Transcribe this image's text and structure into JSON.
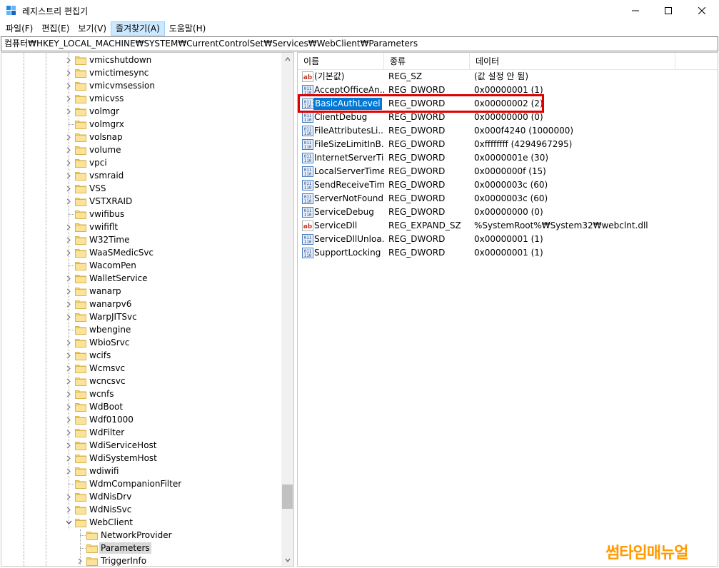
{
  "window": {
    "title": "레지스트리 편집기",
    "minimize_icon": "minimize-icon",
    "maximize_icon": "maximize-icon",
    "close_icon": "close-icon"
  },
  "menu": {
    "items": [
      "파일(F)",
      "편집(E)",
      "보기(V)",
      "즐겨찾기(A)",
      "도움말(H)"
    ],
    "active": "즐겨찾기(A)"
  },
  "address": "컴퓨터₩HKEY_LOCAL_MACHINE₩SYSTEM₩CurrentControlSet₩Services₩WebClient₩Parameters",
  "tree": {
    "items": [
      {
        "label": "vmicshutdown",
        "expander": "collapsed"
      },
      {
        "label": "vmictimesync",
        "expander": "collapsed"
      },
      {
        "label": "vmicvmsession",
        "expander": "collapsed"
      },
      {
        "label": "vmicvss",
        "expander": "collapsed"
      },
      {
        "label": "volmgr",
        "expander": "collapsed"
      },
      {
        "label": "volmgrx",
        "expander": "none"
      },
      {
        "label": "volsnap",
        "expander": "collapsed"
      },
      {
        "label": "volume",
        "expander": "collapsed"
      },
      {
        "label": "vpci",
        "expander": "collapsed"
      },
      {
        "label": "vsmraid",
        "expander": "collapsed"
      },
      {
        "label": "VSS",
        "expander": "collapsed"
      },
      {
        "label": "VSTXRAID",
        "expander": "collapsed"
      },
      {
        "label": "vwifibus",
        "expander": "none"
      },
      {
        "label": "vwififlt",
        "expander": "collapsed"
      },
      {
        "label": "W32Time",
        "expander": "collapsed"
      },
      {
        "label": "WaaSMedicSvc",
        "expander": "collapsed"
      },
      {
        "label": "WacomPen",
        "expander": "none"
      },
      {
        "label": "WalletService",
        "expander": "collapsed"
      },
      {
        "label": "wanarp",
        "expander": "collapsed"
      },
      {
        "label": "wanarpv6",
        "expander": "collapsed"
      },
      {
        "label": "WarpJITSvc",
        "expander": "collapsed"
      },
      {
        "label": "wbengine",
        "expander": "none"
      },
      {
        "label": "WbioSrvc",
        "expander": "collapsed"
      },
      {
        "label": "wcifs",
        "expander": "collapsed"
      },
      {
        "label": "Wcmsvc",
        "expander": "collapsed"
      },
      {
        "label": "wcncsvc",
        "expander": "collapsed"
      },
      {
        "label": "wcnfs",
        "expander": "collapsed"
      },
      {
        "label": "WdBoot",
        "expander": "collapsed"
      },
      {
        "label": "Wdf01000",
        "expander": "collapsed"
      },
      {
        "label": "WdFilter",
        "expander": "collapsed"
      },
      {
        "label": "WdiServiceHost",
        "expander": "collapsed"
      },
      {
        "label": "WdiSystemHost",
        "expander": "collapsed"
      },
      {
        "label": "wdiwifi",
        "expander": "collapsed"
      },
      {
        "label": "WdmCompanionFilter",
        "expander": "none"
      },
      {
        "label": "WdNisDrv",
        "expander": "collapsed"
      },
      {
        "label": "WdNisSvc",
        "expander": "collapsed"
      },
      {
        "label": "WebClient",
        "expander": "expanded"
      },
      {
        "label": "NetworkProvider",
        "expander": "none",
        "child": true
      },
      {
        "label": "Parameters",
        "expander": "none",
        "child": true,
        "selected": true
      },
      {
        "label": "TriggerInfo",
        "expander": "collapsed",
        "child": true
      }
    ]
  },
  "list": {
    "columns": [
      "이름",
      "종류",
      "데이터"
    ],
    "rows": [
      {
        "icon": "string-value-icon",
        "name": "(기본값)",
        "type": "REG_SZ",
        "data": "(값 설정 안 됨)"
      },
      {
        "icon": "binary-value-icon",
        "name": "AcceptOfficeAn...",
        "type": "REG_DWORD",
        "data": "0x00000001 (1)"
      },
      {
        "icon": "binary-value-icon",
        "name": "BasicAuthLevel",
        "type": "REG_DWORD",
        "data": "0x00000002 (2)",
        "selected": true
      },
      {
        "icon": "binary-value-icon",
        "name": "ClientDebug",
        "type": "REG_DWORD",
        "data": "0x00000000 (0)"
      },
      {
        "icon": "binary-value-icon",
        "name": "FileAttributesLi...",
        "type": "REG_DWORD",
        "data": "0x000f4240 (1000000)"
      },
      {
        "icon": "binary-value-icon",
        "name": "FileSizeLimitInB...",
        "type": "REG_DWORD",
        "data": "0xffffffff (4294967295)"
      },
      {
        "icon": "binary-value-icon",
        "name": "InternetServerTi...",
        "type": "REG_DWORD",
        "data": "0x0000001e (30)"
      },
      {
        "icon": "binary-value-icon",
        "name": "LocalServerTime...",
        "type": "REG_DWORD",
        "data": "0x0000000f (15)"
      },
      {
        "icon": "binary-value-icon",
        "name": "SendReceiveTim...",
        "type": "REG_DWORD",
        "data": "0x0000003c (60)"
      },
      {
        "icon": "binary-value-icon",
        "name": "ServerNotFound...",
        "type": "REG_DWORD",
        "data": "0x0000003c (60)"
      },
      {
        "icon": "binary-value-icon",
        "name": "ServiceDebug",
        "type": "REG_DWORD",
        "data": "0x00000000 (0)"
      },
      {
        "icon": "string-value-icon",
        "name": "ServiceDll",
        "type": "REG_EXPAND_SZ",
        "data": "%SystemRoot%₩System32₩webclnt.dll"
      },
      {
        "icon": "binary-value-icon",
        "name": "ServiceDllUnloa...",
        "type": "REG_DWORD",
        "data": "0x00000001 (1)"
      },
      {
        "icon": "binary-value-icon",
        "name": "SupportLocking",
        "type": "REG_DWORD",
        "data": "0x00000001 (1)"
      }
    ]
  },
  "watermark": "썸타임매뉴얼",
  "colors": {
    "selection": "#0078d7",
    "highlight_border": "#e00000",
    "folder": "#f8d775",
    "watermark": "#ff9a00"
  }
}
